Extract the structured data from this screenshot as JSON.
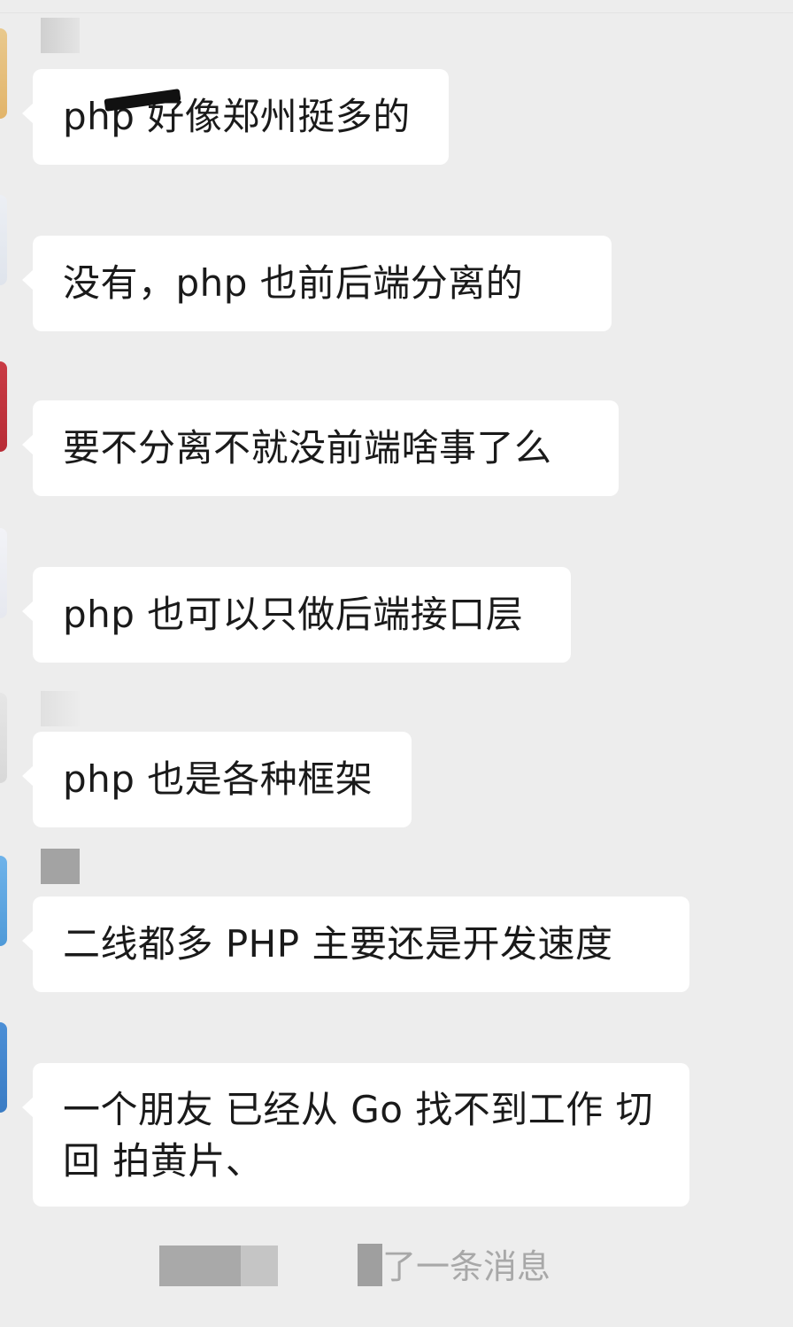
{
  "messages": [
    {
      "text": "php 好像郑州挺多的"
    },
    {
      "text": "没有，php 也前后端分离的"
    },
    {
      "text": "要不分离不就没前端啥事了么"
    },
    {
      "text": "php 也可以只做后端接口层"
    },
    {
      "text": "php 也是各种框架"
    },
    {
      "text": "二线都多 PHP  主要还是开发速度"
    },
    {
      "text": "一个朋友 已经从 Go 找不到工作 切回 拍黄片、"
    }
  ],
  "system_notice": {
    "text": "了一条消息"
  },
  "colors": {
    "background": "#ededed",
    "bubble": "#ffffff",
    "text": "#1a1a1a",
    "system_text": "#a8a8a8"
  }
}
